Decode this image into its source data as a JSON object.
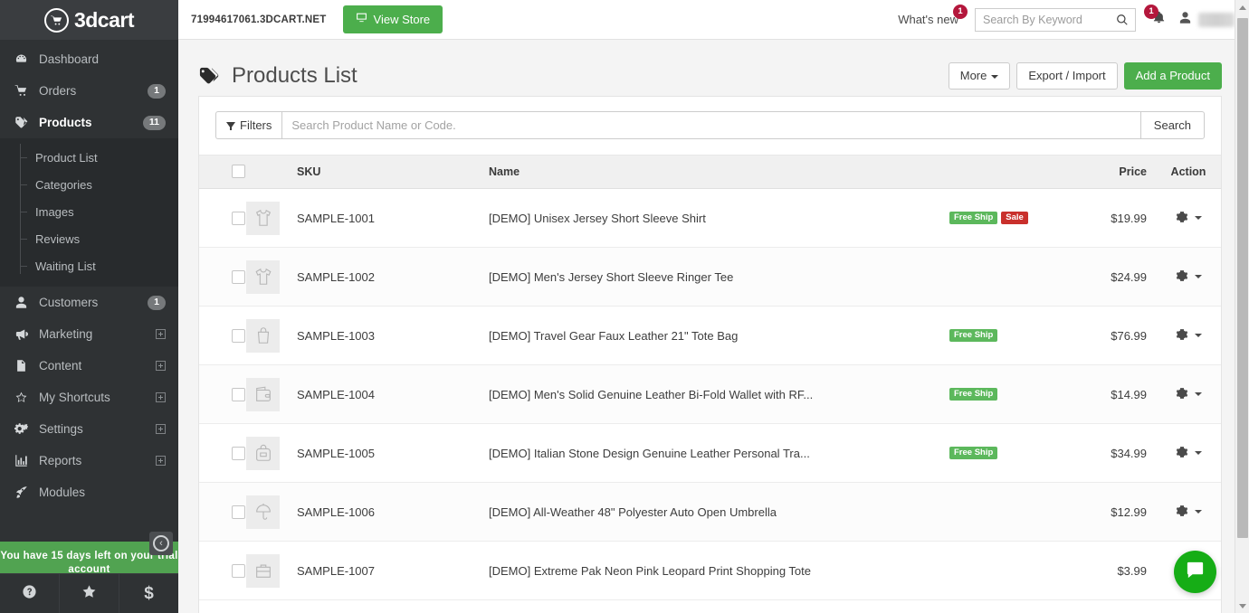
{
  "brand": {
    "name": "3dcart",
    "logo_icon": "cart-circle-icon"
  },
  "topbar": {
    "store_domain": "71994617061.3DCART.NET",
    "view_store_label": "View Store",
    "view_store_icon": "monitor-icon",
    "whats_new_label": "What's new",
    "whats_new_badge": "1",
    "search_placeholder": "Search By Keyword",
    "search_value": "",
    "search_icon": "search-icon",
    "notification_icon": "bell-icon",
    "notification_badge": "1",
    "user_icon": "user-icon",
    "accent_green": "#4cae4c",
    "badge_red": "#b4173c"
  },
  "sidebar": {
    "items": [
      {
        "label": "Dashboard",
        "icon": "dashboard-gauge-icon",
        "count": "",
        "expand": false,
        "active": false
      },
      {
        "label": "Orders",
        "icon": "shopping-cart-icon",
        "count": "1",
        "expand": false,
        "active": false
      },
      {
        "label": "Products",
        "icon": "tag-icon",
        "count": "11",
        "expand": false,
        "active": true
      },
      {
        "label": "Customers",
        "icon": "user-icon",
        "count": "1",
        "expand": false,
        "active": false
      },
      {
        "label": "Marketing",
        "icon": "megaphone-icon",
        "count": "",
        "expand": true,
        "active": false
      },
      {
        "label": "Content",
        "icon": "document-icon",
        "count": "",
        "expand": true,
        "active": false
      },
      {
        "label": "My Shortcuts",
        "icon": "star-icon",
        "count": "",
        "expand": true,
        "active": false
      },
      {
        "label": "Settings",
        "icon": "gears-icon",
        "count": "",
        "expand": true,
        "active": false
      },
      {
        "label": "Reports",
        "icon": "bar-chart-icon",
        "count": "",
        "expand": true,
        "active": false
      },
      {
        "label": "Modules",
        "icon": "rocket-icon",
        "count": "",
        "expand": false,
        "active": false
      }
    ],
    "sub_items": [
      {
        "label": "Product List"
      },
      {
        "label": "Categories"
      },
      {
        "label": "Images"
      },
      {
        "label": "Reviews"
      },
      {
        "label": "Waiting List"
      }
    ],
    "trial_banner": "You have 15 days left on your trial account",
    "trial_banner_color": "#51a351",
    "collapse_icon": "arrow-left-circle-icon",
    "footer_buttons": [
      {
        "icon": "help-question-icon",
        "label": ""
      },
      {
        "icon": "star-icon",
        "label": ""
      },
      {
        "icon": "dollar-icon",
        "label": "$"
      }
    ]
  },
  "page": {
    "title": "Products List",
    "title_icon": "tags-icon",
    "actions": [
      {
        "label": "More",
        "style": "default",
        "caret": true
      },
      {
        "label": "Export / Import",
        "style": "default",
        "caret": false
      },
      {
        "label": "Add a Product",
        "style": "success",
        "caret": false
      }
    ]
  },
  "toolbar": {
    "filters_label": "Filters",
    "filters_icon": "funnel-icon",
    "search_placeholder": "Search Product Name or Code.",
    "search_value": "",
    "search_button_label": "Search"
  },
  "table": {
    "columns": [
      "",
      "",
      "SKU",
      "Name",
      "",
      "Price",
      "Action"
    ],
    "headers": {
      "sku": "SKU",
      "name": "Name",
      "price": "Price",
      "action": "Action"
    },
    "rows": [
      {
        "sku": "SAMPLE-1001",
        "name": "[DEMO] Unisex Jersey Short Sleeve Shirt",
        "badges": [
          "Free Ship",
          "Sale"
        ],
        "price": "$19.99",
        "thumb_icon": "tshirt-icon"
      },
      {
        "sku": "SAMPLE-1002",
        "name": "[DEMO] Men's Jersey Short Sleeve Ringer Tee",
        "badges": [],
        "price": "$24.99",
        "thumb_icon": "tshirt-icon"
      },
      {
        "sku": "SAMPLE-1003",
        "name": "[DEMO] Travel Gear Faux Leather 21\" Tote Bag",
        "badges": [
          "Free Ship"
        ],
        "price": "$76.99",
        "thumb_icon": "tote-bag-icon"
      },
      {
        "sku": "SAMPLE-1004",
        "name": "[DEMO] Men's Solid Genuine Leather Bi-Fold Wallet with RF...",
        "badges": [
          "Free Ship"
        ],
        "price": "$14.99",
        "thumb_icon": "wallet-icon"
      },
      {
        "sku": "SAMPLE-1005",
        "name": "[DEMO] Italian Stone Design Genuine Leather Personal Tra...",
        "badges": [
          "Free Ship"
        ],
        "price": "$34.99",
        "thumb_icon": "backpack-icon"
      },
      {
        "sku": "SAMPLE-1006",
        "name": "[DEMO] All-Weather 48\" Polyester Auto Open Umbrella",
        "badges": [],
        "price": "$12.99",
        "thumb_icon": "umbrella-icon"
      },
      {
        "sku": "SAMPLE-1007",
        "name": "[DEMO] Extreme Pak Neon Pink Leopard Print Shopping Tote",
        "badges": [],
        "price": "$3.99",
        "thumb_icon": "briefcase-icon"
      }
    ],
    "row_action_icon": "gear-icon",
    "badge_colors": {
      "Free Ship": "#5cb85c",
      "Sale": "#c9302c"
    }
  },
  "chat": {
    "icon": "chat-bubble-icon",
    "color": "#16ad16"
  }
}
